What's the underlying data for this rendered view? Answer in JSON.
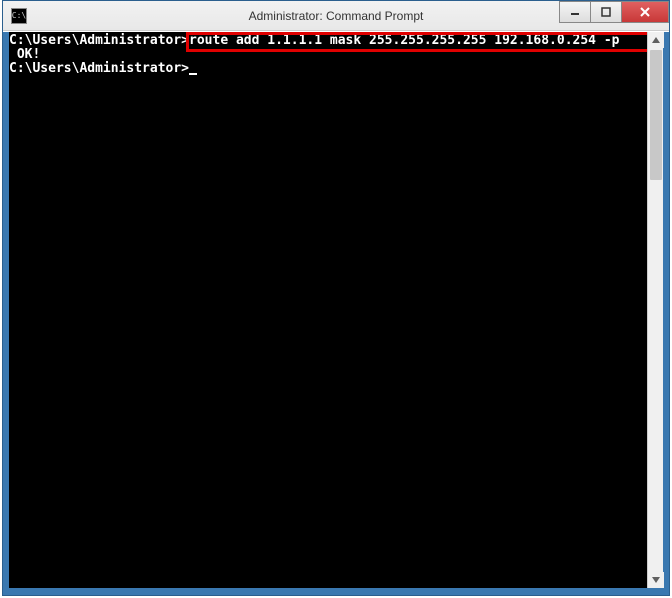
{
  "window": {
    "title": "Administrator: Command Prompt",
    "icon_text": "C:\\"
  },
  "console": {
    "line1_prompt": "C:\\Users\\Administrator>",
    "line1_command": "route add 1.1.1.1 mask 255.255.255.255 192.168.0.254 -p",
    "line2": " OK!",
    "line3": "",
    "line4_prompt": "C:\\Users\\Administrator>"
  }
}
